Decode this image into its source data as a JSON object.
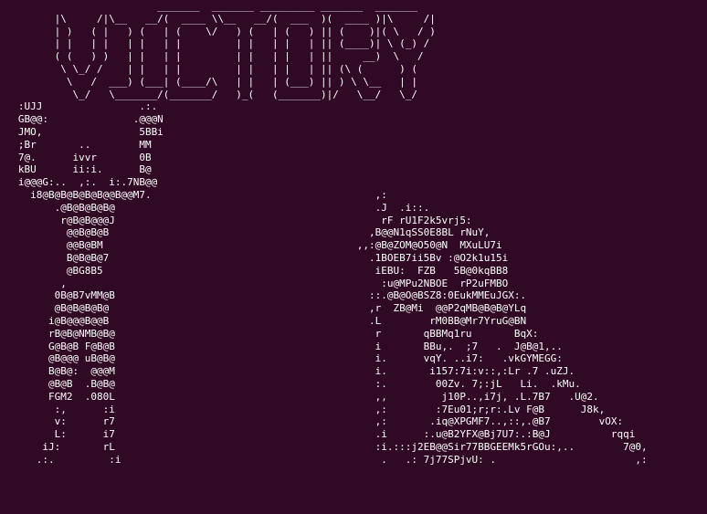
{
  "terminal": {
    "lines": [
      "                          _______  _______ _________ _______  _______          ",
      "         |\\     /|\\__   __/(  ____ \\\\__   __/(  ___  )(  ____ )|\\     /|",
      "         | )   ( |   ) (   | (    \\/   ) (   | (   ) || (    )|( \\   / )",
      "         | |   | |   | |   | |         | |   | |   | || (____)| \\ (_) / ",
      "         ( (   ) )   | |   | |         | |   | |   | ||     __)  \\   /  ",
      "          \\ \\_/ /    | |   | |         | |   | |   | || (\\ (      ) (   ",
      "           \\   /  ___) (___| (____/\\   | |   | (___) || ) \\ \\__   | |   ",
      "            \\_/   \\_______/(_______/   )_(   (_______)|/   \\__/   \\_/   ",
      "   :UJJ                .:.",
      "   GB@@:              .@@@N",
      "   JMO,                5BBi",
      "   ;Br       ..        MM",
      "   7@.      ivvr       0B",
      "   kBU      ii:i.      B@",
      "   i@@@G:..  ,:.  i:.7NB@@",
      "     i8@B@B@B@B@B@@B@@M7.                                     ,:",
      "         .@B@B@B@B@                                           .J  .i::.",
      "          r@B@B@@@J                                            rF rU1F2k5vrj5:",
      "           @@B@B@B                                           ,B@@N1qSS0E8BL rNuY,",
      "           @@B@BM                                          ,,:@B@ZOM@O50@N  MXuLU7i",
      "           B@B@B@7                                           .1BOEB7ii5Bv :@O2k1u15i",
      "           @BG8B5                                             iEBU:  FZB   5B@0kqBB8",
      "          ,                                                    :u@MPu2NBOE  rP2uFMBO",
      "         0B@B7vMM@B                                          ::.@B@O@BSZ8:0EukMMEuJGX:.",
      "         @B@B@B@B@                                           ,r  ZB@Mi  @@P2qMB@B@B@YLq",
      "        i@B@@@B@@B                                           .L        rM0BB@Mr7YruG@BN",
      "        rB@B@NMB@B@                                           r       qBBMq1ru       BqX:",
      "        G@B@B F@B@B                                           i       BBu,.  ;7   .  J@B@1,..",
      "        @B@@@ uB@B@                                           i.      vqY. ..i7:   .vkGYMEGG:",
      "        B@B@:  @@@M                                           i.       i157:7i:v::,:Lr .7 .uZJ.",
      "        @B@B  .B@B@                                           :.        00Zv. 7;:jL   Li.  .kMu.",
      "        FGM2  .080L                                           ,,         j10P..,i7j, .L.7B7   .U@2.",
      "         :,      :i                                           ,:        :7Eu01;r;r:.Lv F@B      J8k,",
      "         v:      r7                                           ,:       .iq@XPGMF7..,::,.@B7        vOX:",
      "         L:      i7                                           .i      :.u@B2YFX@Bj7U7:.:B@J          rqqi",
      "       iJ:       rL                                           :i.:::j2EB@@Sir77BBGEEMk5rGOu:,..        7@0,",
      "      .:.         :i                                           .   .: 7j77SPjvU: .                       ,:"
    ]
  }
}
